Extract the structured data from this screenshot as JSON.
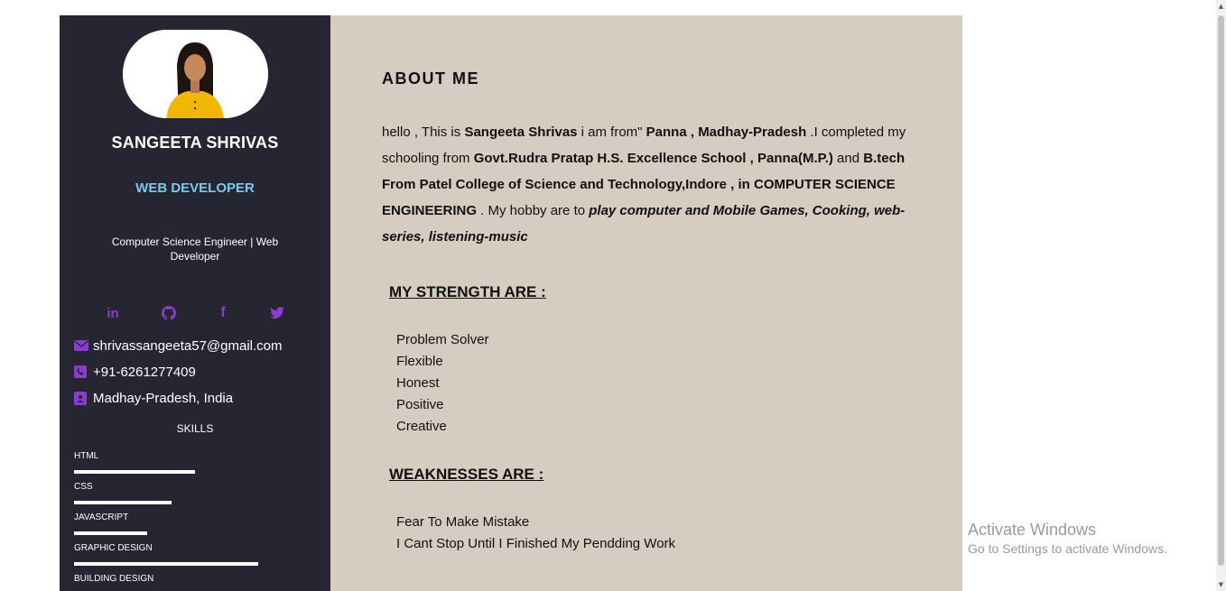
{
  "profile": {
    "name": "SANGEETA SHRIVAS",
    "role": "WEB DEVELOPER",
    "tagline": "Computer Science Engineer | Web Developer"
  },
  "social": [
    {
      "icon": "linkedin-icon",
      "glyph": "in"
    },
    {
      "icon": "github-icon"
    },
    {
      "icon": "facebook-icon",
      "glyph": "f"
    },
    {
      "icon": "twitter-icon"
    }
  ],
  "contact": {
    "email": "shrivassangeeta57@gmail.com",
    "phone": "+91-6261277409",
    "location": "Madhay-Pradesh, India"
  },
  "skills": {
    "title": "SKILLS",
    "items": [
      {
        "label": "HTML",
        "level": 0.45
      },
      {
        "label": "CSS",
        "level": 0.36
      },
      {
        "label": "JAVASCRIPT",
        "level": 0.27
      },
      {
        "label": "GRAPHIC DESIGN",
        "level": 0.68
      },
      {
        "label": "BUILDING DESIGN"
      }
    ]
  },
  "about": {
    "title": "ABOUT ME",
    "t1": "hello , This is ",
    "b1": "Sangeeta Shrivas",
    "t2": " i am from\" ",
    "b2": "Panna , Madhay-Pradesh",
    "t3": " .I completed my schooling from ",
    "b3": "Govt.Rudra Pratap H.S. Excellence School , Panna(M.P.)",
    "t4": " and ",
    "b4": "B.tech From Patel College of Science and Technology,Indore , in COMPUTER SCIENCE ENGINEERING",
    "t5": " . My hobby are to ",
    "b5": "play computer and Mobile Games, Cooking, web-series, listening-music"
  },
  "strengths": {
    "title": "MY STRENGTH ARE :",
    "items": [
      "Problem Solver",
      "Flexible",
      "Honest",
      "Positive",
      "Creative"
    ]
  },
  "weaknesses": {
    "title": "WEAKNESSES ARE :",
    "items": [
      "Fear To Make Mistake",
      "I Cant Stop Until I Finished My Pendding Work"
    ]
  },
  "watermark": {
    "line1": "Activate Windows",
    "line2": "Go to Settings to activate Windows."
  },
  "colors": {
    "sidebar_bg": "#262632",
    "main_bg": "#d6ccc2",
    "accent_purple": "#8a3ccf",
    "role_blue": "#7ec8ea"
  }
}
